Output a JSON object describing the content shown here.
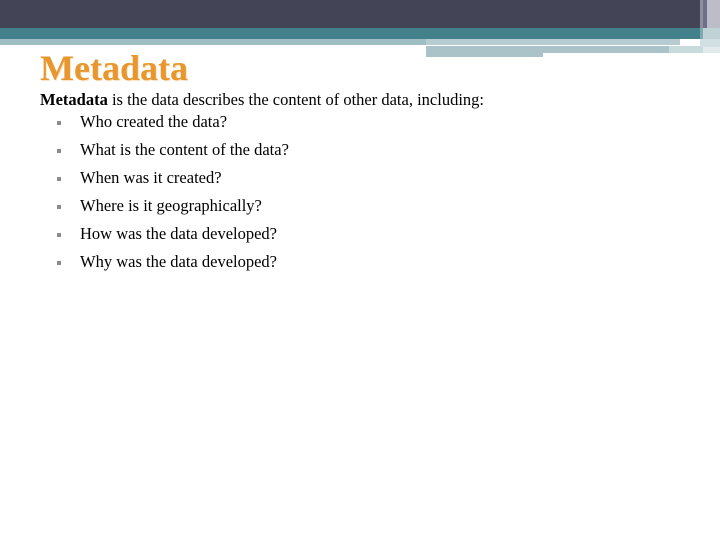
{
  "slide": {
    "title": "Metadata",
    "intro": {
      "lead": "Metadata",
      "rest": " is the data describes the content of other data, including:"
    },
    "bullets": [
      {
        "text": "Who created the data?"
      },
      {
        "text": "What is the content of the data?"
      },
      {
        "text": "When was it created?"
      },
      {
        "text": "Where is it geographically?"
      },
      {
        "text": "How was the data developed?"
      },
      {
        "text": "Why was the data developed?"
      }
    ]
  },
  "theme": {
    "navy": "#434455",
    "teal": "#42818A",
    "light_blue": "#9FBEC3",
    "pale_blue": "#C9DADD",
    "title_orange": "#E8962E",
    "body_black": "#000000",
    "bullet_gray": "#8C8C8C",
    "background": "#FFFFFF"
  }
}
